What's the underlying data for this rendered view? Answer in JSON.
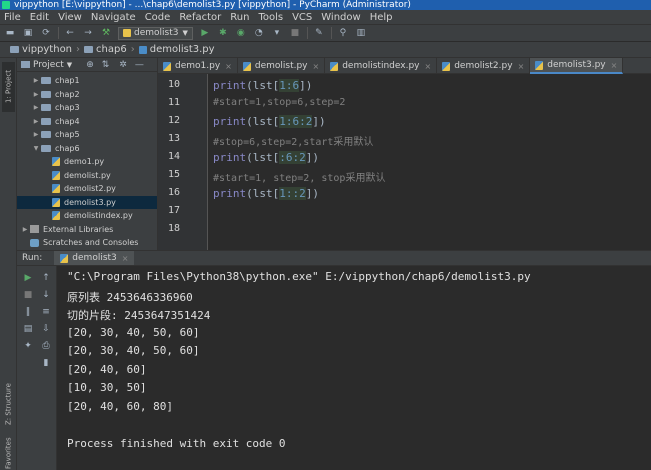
{
  "window": {
    "title": "vippython [E:\\vippython] - ...\\chap6\\demolist3.py [vippython] - PyCharm (Administrator)"
  },
  "menu": [
    "File",
    "Edit",
    "View",
    "Navigate",
    "Code",
    "Refactor",
    "Run",
    "Tools",
    "VCS",
    "Window",
    "Help"
  ],
  "toolbar": {
    "run_config": "demolist3"
  },
  "breadcrumb": {
    "project": "vippython",
    "folder": "chap6",
    "file": "demolist3.py"
  },
  "project_panel": {
    "title": "Project",
    "tree": [
      {
        "label": "chap1",
        "kind": "folder",
        "level": 1,
        "expanded": false
      },
      {
        "label": "chap2",
        "kind": "folder",
        "level": 1,
        "expanded": false
      },
      {
        "label": "chap3",
        "kind": "folder",
        "level": 1,
        "expanded": false
      },
      {
        "label": "chap4",
        "kind": "folder",
        "level": 1,
        "expanded": false
      },
      {
        "label": "chap5",
        "kind": "folder",
        "level": 1,
        "expanded": false
      },
      {
        "label": "chap6",
        "kind": "folder",
        "level": 1,
        "expanded": true
      },
      {
        "label": "demo1.py",
        "kind": "py",
        "level": 2
      },
      {
        "label": "demolist.py",
        "kind": "py",
        "level": 2
      },
      {
        "label": "demolist2.py",
        "kind": "py",
        "level": 2
      },
      {
        "label": "demolist3.py",
        "kind": "py",
        "level": 2,
        "selected": true
      },
      {
        "label": "demolistindex.py",
        "kind": "py",
        "level": 2
      },
      {
        "label": "External Libraries",
        "kind": "lib",
        "level": 0,
        "expanded": false
      },
      {
        "label": "Scratches and Consoles",
        "kind": "scratch",
        "level": 0
      }
    ]
  },
  "editor_tabs": [
    {
      "label": "demo1.py",
      "active": false
    },
    {
      "label": "demolist.py",
      "active": false
    },
    {
      "label": "demolistindex.py",
      "active": false
    },
    {
      "label": "demolist2.py",
      "active": false
    },
    {
      "label": "demolist3.py",
      "active": true
    }
  ],
  "editor": {
    "line_numbers": [
      "10",
      "11",
      "12",
      "13",
      "14",
      "15",
      "16",
      "17",
      "18"
    ],
    "lines": [
      {
        "type": "code",
        "pre": "print",
        "arg": "(lst[",
        "slice": "1:6",
        "post": "])"
      },
      {
        "type": "comment",
        "text": "#start=1,stop=6,step=2"
      },
      {
        "type": "code",
        "pre": "print",
        "arg": "(lst[",
        "slice": "1:6:2",
        "post": "])"
      },
      {
        "type": "comment",
        "text": "#stop=6,step=2,start采用默认"
      },
      {
        "type": "code",
        "pre": "print",
        "arg": "(lst[",
        "slice": ":6:2",
        "post": "])"
      },
      {
        "type": "comment",
        "text": "#start=1, step=2, stop采用默认"
      },
      {
        "type": "code",
        "pre": "print",
        "arg": "(lst[",
        "slice": "1::2",
        "post": "])"
      },
      {
        "type": "empty"
      },
      {
        "type": "empty"
      }
    ]
  },
  "run_panel": {
    "label": "Run:",
    "tab": "demolist3",
    "output": [
      "\"C:\\Program Files\\Python38\\python.exe\" E:/vippython/chap6/demolist3.py",
      "原列表 2453646336960",
      "切的片段: 2453647351424",
      "[20, 30, 40, 50, 60]",
      "[20, 30, 40, 50, 60]",
      "[20, 40, 60]",
      "[10, 30, 50]",
      "[20, 40, 60, 80]",
      "",
      "Process finished with exit code 0"
    ]
  },
  "side_tabs": {
    "project": "1: Project",
    "structure": "Z: Structure",
    "favorites": "Favorites"
  }
}
